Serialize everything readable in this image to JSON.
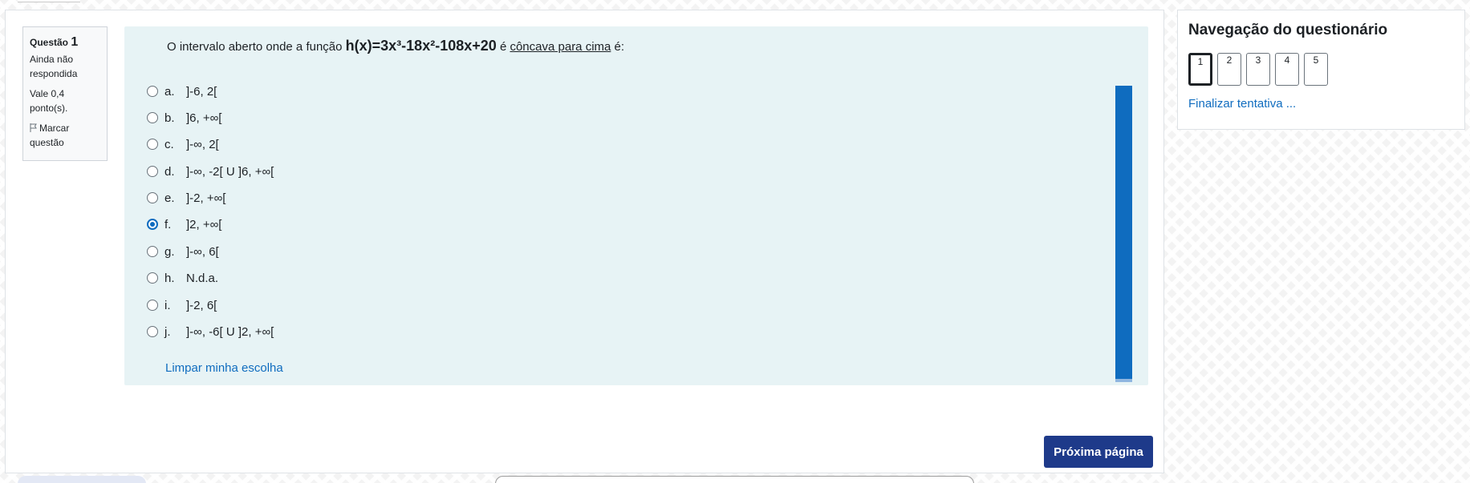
{
  "question": {
    "label": "Questão",
    "number": "1",
    "state": "Ainda não respondida",
    "grade": "Vale 0,4 ponto(s).",
    "flag_label": "Marcar questão",
    "text_before": "O intervalo aberto onde a função ",
    "function": "h(x)=3x³-18x²-108x+20",
    "text_middle": " é ",
    "concave": "côncava para cima",
    "text_after": " é:",
    "answers": [
      {
        "letter": "a.",
        "text": "]-6, 2[",
        "checked": false
      },
      {
        "letter": "b.",
        "text": "]6, +∞[",
        "checked": false
      },
      {
        "letter": "c.",
        "text": "]-∞, 2[",
        "checked": false
      },
      {
        "letter": "d.",
        "text": "]-∞, -2[ U ]6, +∞[",
        "checked": false
      },
      {
        "letter": "e.",
        "text": "]-2, +∞[",
        "checked": false
      },
      {
        "letter": "f.",
        "text": "]2, +∞[",
        "checked": true
      },
      {
        "letter": "g.",
        "text": "]-∞, 6[",
        "checked": false
      },
      {
        "letter": "h.",
        "text": "N.d.a.",
        "checked": false
      },
      {
        "letter": "i.",
        "text": "]-2, 6[",
        "checked": false
      },
      {
        "letter": "j.",
        "text": "]-∞, -6[ U ]2, +∞[",
        "checked": false
      }
    ],
    "clear_choice": "Limpar minha escolha"
  },
  "next_button": "Próxima página",
  "navigation": {
    "title": "Navegação do questionário",
    "buttons": [
      "1",
      "2",
      "3",
      "4",
      "5"
    ],
    "current": "1",
    "finish_link": "Finalizar tentativa ..."
  },
  "colors": {
    "accent": "#0f6cbf",
    "primary_button": "#1e3a8a",
    "formulation_bg": "#e7f3f5"
  }
}
